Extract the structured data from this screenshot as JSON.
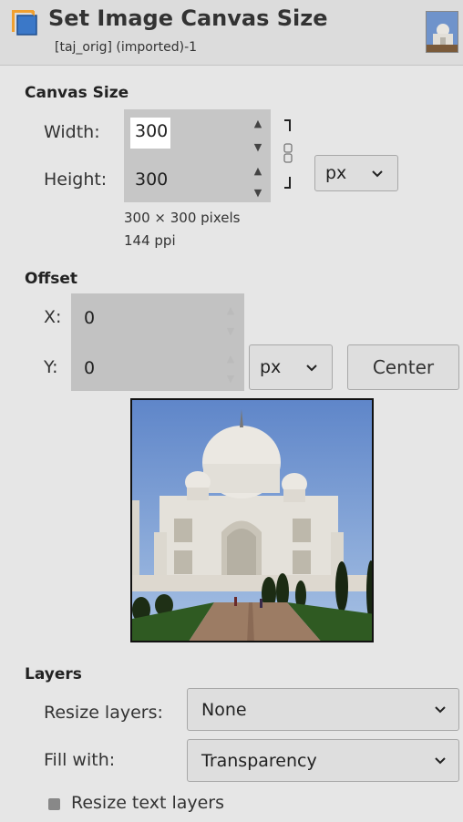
{
  "header": {
    "title": "Set Image Canvas Size",
    "subtitle": "[taj_orig] (imported)-1"
  },
  "canvas_size": {
    "section_title": "Canvas Size",
    "width_label": "Width:",
    "width_value": "300",
    "height_label": "Height:",
    "height_value": "300",
    "unit": "px",
    "dims_text": "300 × 300 pixels",
    "ppi_text": "144 ppi"
  },
  "offset": {
    "section_title": "Offset",
    "x_label": "X:",
    "x_value": "0",
    "y_label": "Y:",
    "y_value": "0",
    "unit": "px",
    "center_label": "Center"
  },
  "layers": {
    "section_title": "Layers",
    "resize_label": "Resize layers:",
    "resize_value": "None",
    "fill_label": "Fill with:",
    "fill_value": "Transparency",
    "resize_text_label": "Resize text layers"
  }
}
